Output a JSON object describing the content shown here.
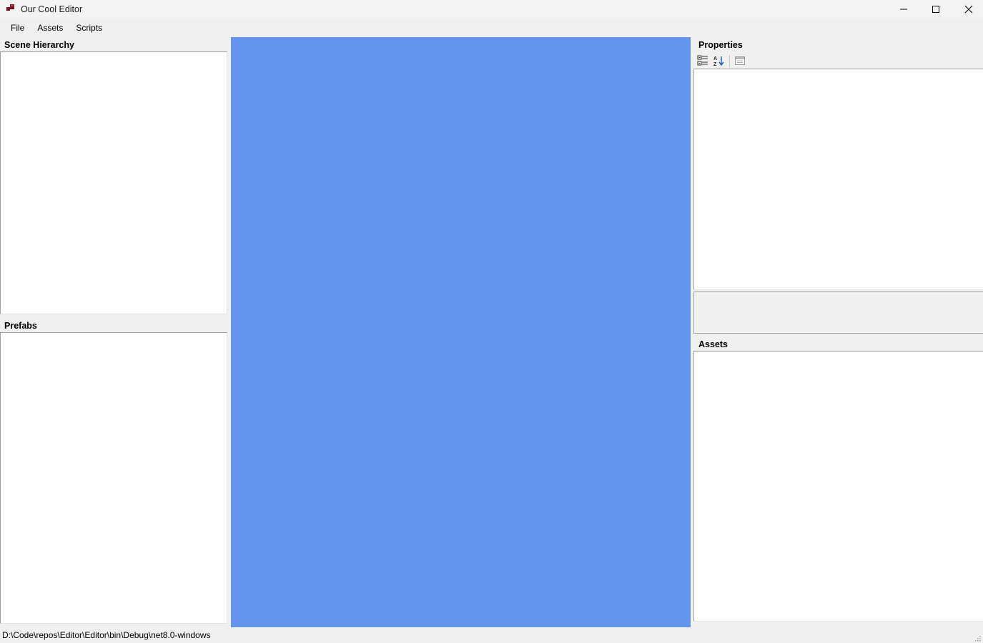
{
  "window": {
    "title": "Our Cool Editor",
    "icon": "app-icon",
    "controls": [
      "minimize-icon",
      "maximize-icon",
      "close-icon"
    ]
  },
  "menu": {
    "items": [
      {
        "label": "File"
      },
      {
        "label": "Assets"
      },
      {
        "label": "Scripts"
      }
    ]
  },
  "scene_hierarchy": {
    "title": "Scene Hierarchy"
  },
  "prefabs": {
    "title": "Prefabs"
  },
  "viewport": {
    "background_color": "#6495ed"
  },
  "properties": {
    "title": "Properties",
    "toolbar": [
      "categorized-icon",
      "alphabetical-sort-icon",
      "property-pages-icon"
    ]
  },
  "assets": {
    "title": "Assets"
  },
  "status": {
    "path": "D:\\Code\\repos\\Editor\\Editor\\bin\\Debug\\net8.0-windows"
  }
}
